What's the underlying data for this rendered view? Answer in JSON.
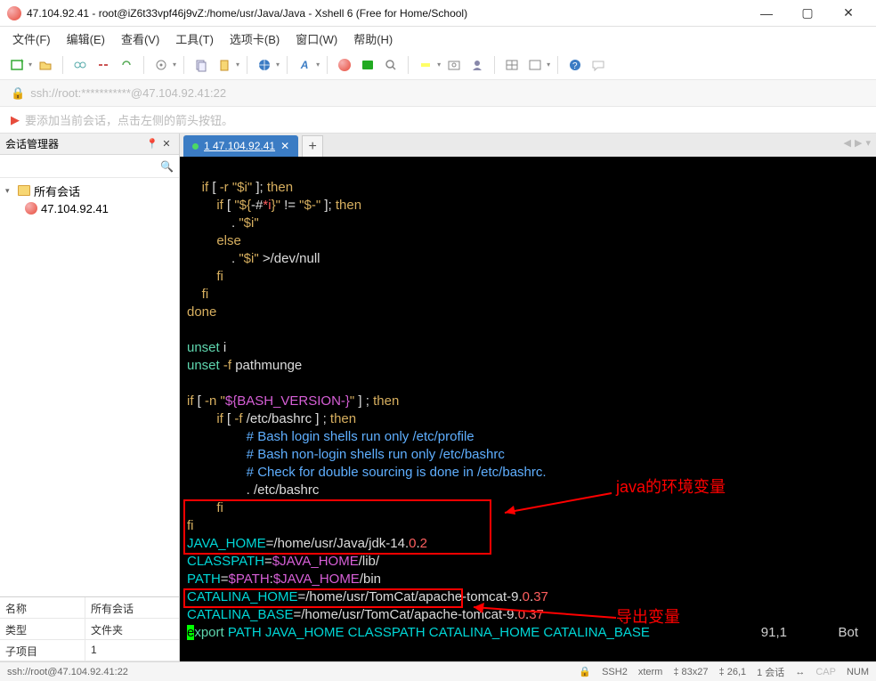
{
  "window": {
    "title": "47.104.92.41 - root@iZ6t33vpf46j9vZ:/home/usr/Java/Java - Xshell 6 (Free for Home/School)",
    "min": "—",
    "max": "▢",
    "close": "✕"
  },
  "menu": {
    "file": "文件(F)",
    "edit": "编辑(E)",
    "view": "查看(V)",
    "tools": "工具(T)",
    "tab": "选项卡(B)",
    "window": "窗口(W)",
    "help": "帮助(H)"
  },
  "address": {
    "text": "ssh://root:***********@47.104.92.41:22"
  },
  "hint": {
    "text": "要添加当前会话，点击左侧的箭头按钮。"
  },
  "sidebar": {
    "title": "会话管理器",
    "pin": "📌",
    "close": "✕",
    "search_ph": "",
    "root": "所有会话",
    "session": "47.104.92.41"
  },
  "props": {
    "name_k": "名称",
    "name_v": "所有会话",
    "type_k": "类型",
    "type_v": "文件夹",
    "child_k": "子项目",
    "child_v": "1"
  },
  "tab": {
    "label": "1 47.104.92.41",
    "add": "+"
  },
  "terminal": {
    "l1a": "    if",
    "l1b": " [ ",
    "l1c": "-r \"$i\"",
    "l1d": " ]; ",
    "l1e": "then",
    "l2a": "        if",
    "l2b": " [ ",
    "l2c": "\"${",
    "l2d": "-#",
    "l2e": "*i",
    "l2f": "}\"",
    "l2g": " != ",
    "l2h": "\"$-\"",
    "l2i": " ]; ",
    "l2j": "then",
    "l3a": "            . ",
    "l3b": "\"$i\"",
    "l4a": "        else",
    "l5a": "            . ",
    "l5b": "\"$i\"",
    "l5c": " >/dev/null",
    "l6a": "        fi",
    "l7a": "    fi",
    "l8a": "done",
    "l9": "",
    "l10a": "unset",
    "l10b": " i",
    "l11a": "unset",
    "l11b": " -f",
    "l11c": " pathmunge",
    "l12": "",
    "l13a": "if",
    "l13b": " [ ",
    "l13c": "-n \"",
    "l13d": "${BASH_VERSION-}",
    "l13e": "\"",
    "l13f": " ] ; ",
    "l13g": "then",
    "l14a": "        if",
    "l14b": " [ ",
    "l14c": "-f",
    "l14d": " /etc/bashrc ] ; ",
    "l14e": "then",
    "l15": "                # Bash login shells run only /etc/profile",
    "l16": "                # Bash non-login shells run only /etc/bashrc",
    "l17": "                # Check for double sourcing is done in /etc/bashrc.",
    "l18": "                . /etc/bashrc",
    "l19a": "        fi",
    "l20a": "fi",
    "l21a": "JAVA_HOME",
    "l21b": "=/home/usr/Java/jdk-14.",
    "l21c": "0",
    "l21d": ".",
    "l21e": "2",
    "l22a": "CLASSPATH",
    "l22b": "=",
    "l22c": "$JAVA_HOME",
    "l22d": "/lib/",
    "l23a": "PATH",
    "l23b": "=",
    "l23c": "$PATH",
    "l23d": ":",
    "l23e": "$JAVA_HOME",
    "l23f": "/bin",
    "l24a": "CATALINA_HOME",
    "l24b": "=/home/usr/TomCat/apache-tomcat-9.",
    "l24c": "0",
    "l24d": ".",
    "l24e": "37",
    "l25a": "CATALINA_BASE",
    "l25b": "=/home/usr/TomCat/apache-tomcat-9.",
    "l25c": "0",
    "l25d": ".",
    "l25e": "37",
    "l26a": "e",
    "l26b": "xport",
    "l26c": " PATH",
    "l26d": " JAVA_HOME",
    "l26e": " CLASSPATH",
    "l26f": " CATALINA_HOME CATALINA_BASE",
    "pos": "91,1",
    "bot": "Bot"
  },
  "annotations": {
    "java_env": "java的环境变量",
    "export_var": "导出变量"
  },
  "status": {
    "left": "ssh://root@47.104.92.41:22",
    "ssh": "SSH2",
    "term": "xterm",
    "size": "83x27",
    "rc": "26,1",
    "sess": "1 会话",
    "cap": "CAP",
    "num": "NUM"
  }
}
